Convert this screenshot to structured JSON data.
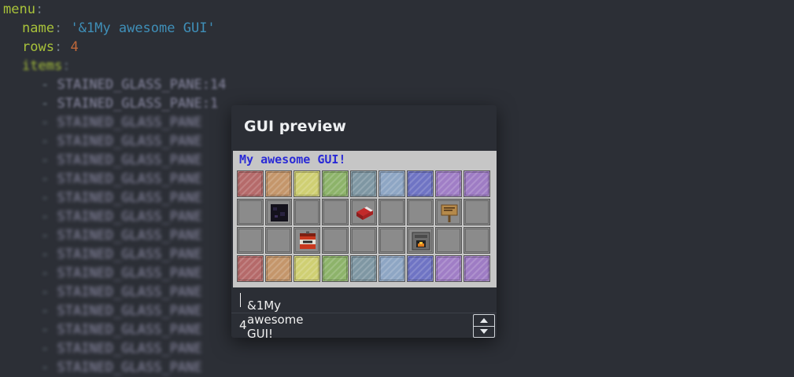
{
  "editor": {
    "line_menu": "menu",
    "line_name_key": "name",
    "line_name_value": "'&1My awesome GUI'",
    "line_rows_key": "rows",
    "line_rows_value": "4",
    "line_items_key": "items",
    "item_lines": [
      "STAINED_GLASS_PANE:14",
      "STAINED_GLASS_PANE:1",
      "STAINED_GLASS_PANE",
      "STAINED_GLASS_PANE",
      "STAINED_GLASS_PANE",
      "STAINED_GLASS_PANE",
      "STAINED_GLASS_PANE",
      "STAINED_GLASS_PANE",
      "STAINED_GLASS_PANE",
      "STAINED_GLASS_PANE",
      "STAINED_GLASS_PANE",
      "STAINED_GLASS_PANE",
      "STAINED_GLASS_PANE",
      "STAINED_GLASS_PANE",
      "STAINED_GLASS_PANE",
      "STAINED_GLASS_PANE"
    ],
    "colors": {
      "key": "#a8c23a",
      "string": "#3f8fb8",
      "number": "#c0683a",
      "background": "#2c2f36"
    }
  },
  "dialog": {
    "title": "GUI preview",
    "gui_title": "My awesome GUI!",
    "gui_title_color": "#2a2ad6",
    "name_value": "&1My awesome GUI!",
    "rows_value": "4",
    "spinner_up_icon": "triangle-up-icon",
    "spinner_down_icon": "triangle-down-icon"
  },
  "grid": {
    "rows": 4,
    "cols": 9,
    "pane_colors": [
      "#b56a6a",
      "#c4966b",
      "#cfcf73",
      "#8db36a",
      "#7f97a3",
      "#8ea6c4",
      "#6f74c4",
      "#a07ec6",
      "#9e7cc4"
    ],
    "middle_items": [
      [
        "",
        "obsidian-icon",
        "",
        "",
        "bed-icon",
        "",
        "",
        "sign-icon",
        ""
      ],
      [
        "",
        "",
        "tnt-icon",
        "",
        "",
        "",
        "furnace-icon",
        "",
        ""
      ]
    ]
  }
}
